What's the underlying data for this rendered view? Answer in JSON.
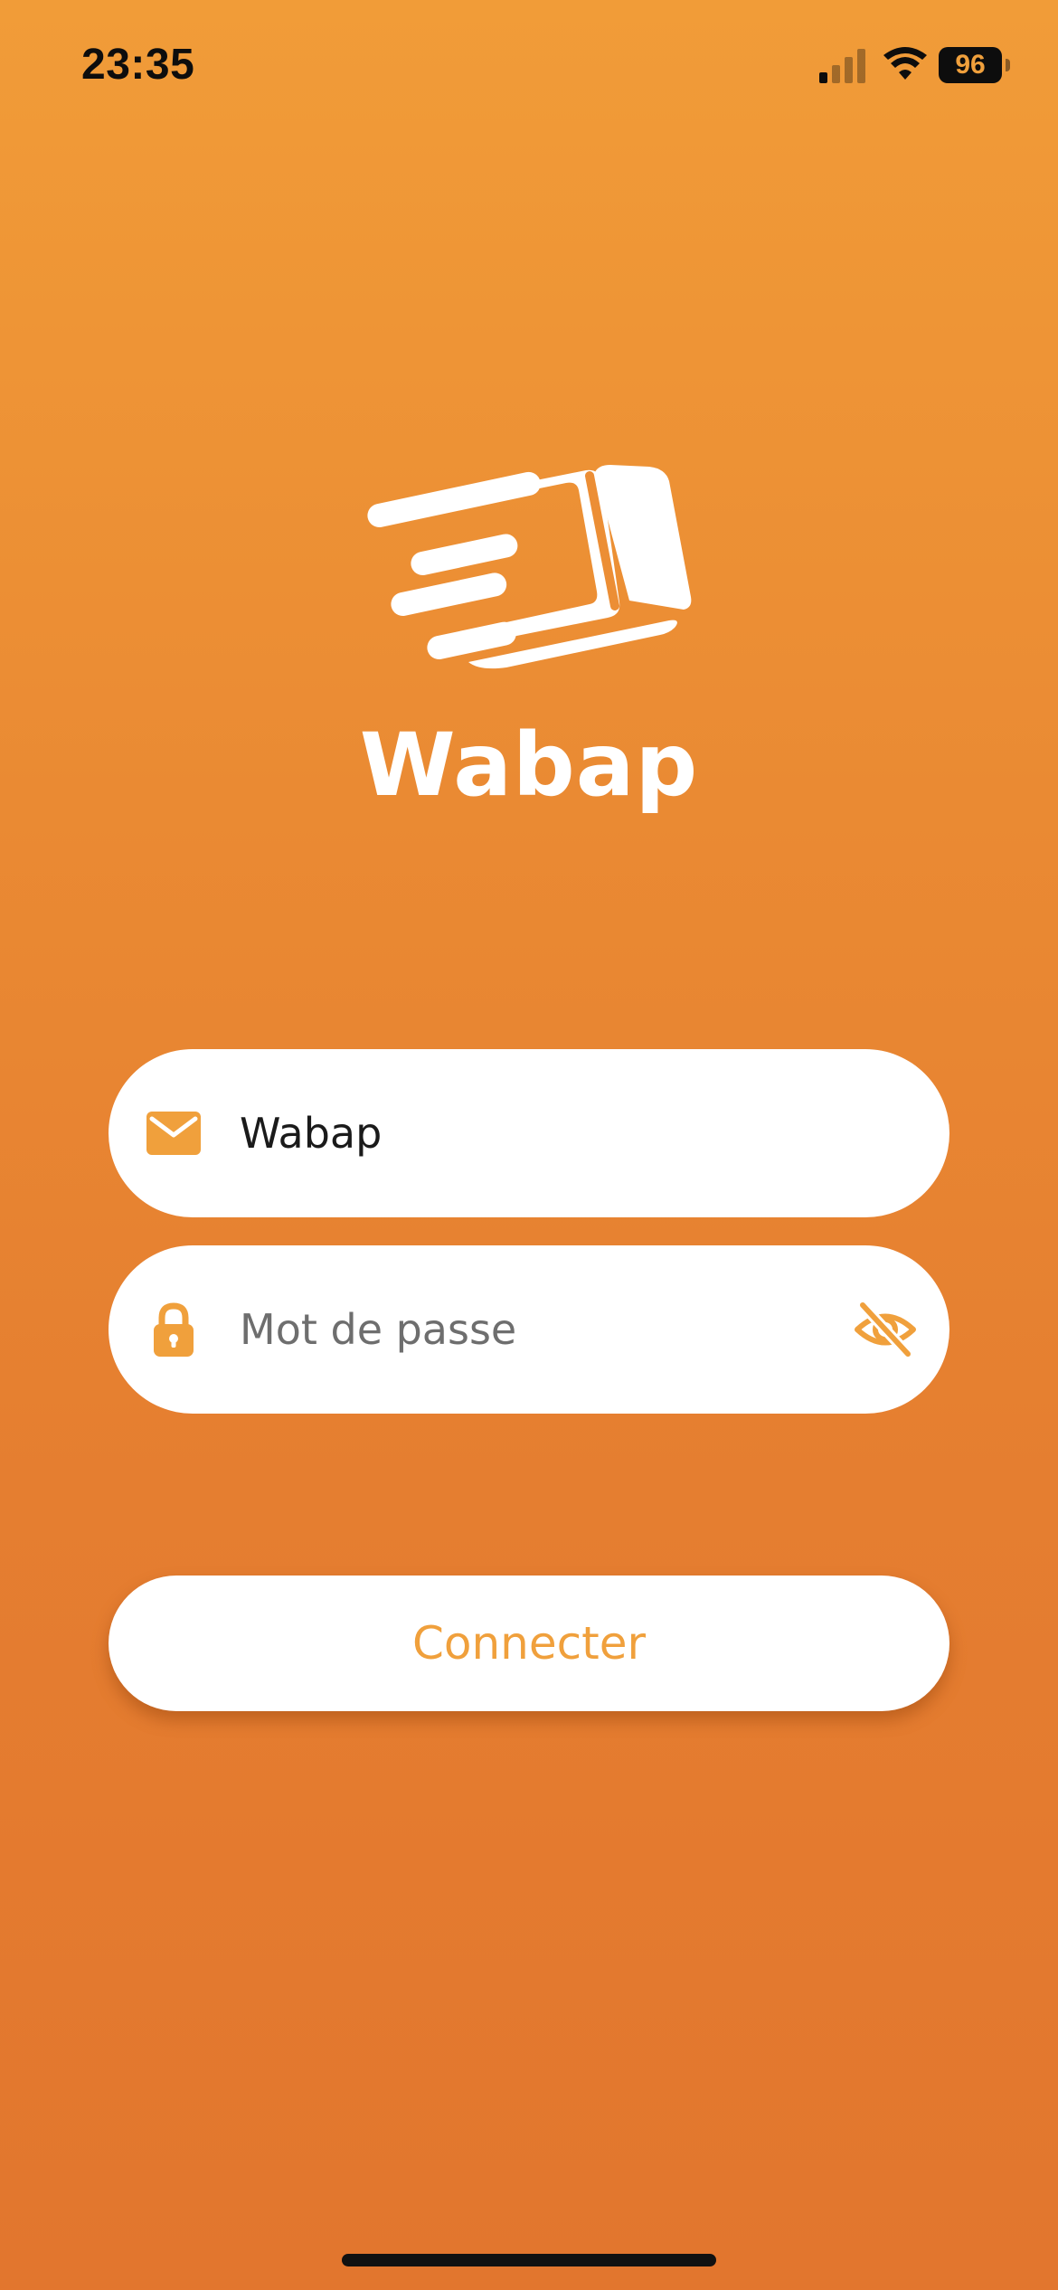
{
  "status_bar": {
    "time": "23:35",
    "battery": "96",
    "signal_icon": "cellular-signal-icon",
    "wifi_icon": "wifi-icon"
  },
  "app": {
    "name": "Wabap",
    "logo_icon": "fast-package-logo"
  },
  "form": {
    "email": {
      "icon": "envelope-icon",
      "value": "Wabap"
    },
    "password": {
      "icon": "lock-icon",
      "placeholder": "Mot de passe",
      "toggle_icon": "eye-slash-icon"
    },
    "submit_label": "Connecter"
  },
  "colors": {
    "accent": "#F0A03C",
    "background_top": "#F19C38",
    "background_bottom": "#E2762E"
  }
}
